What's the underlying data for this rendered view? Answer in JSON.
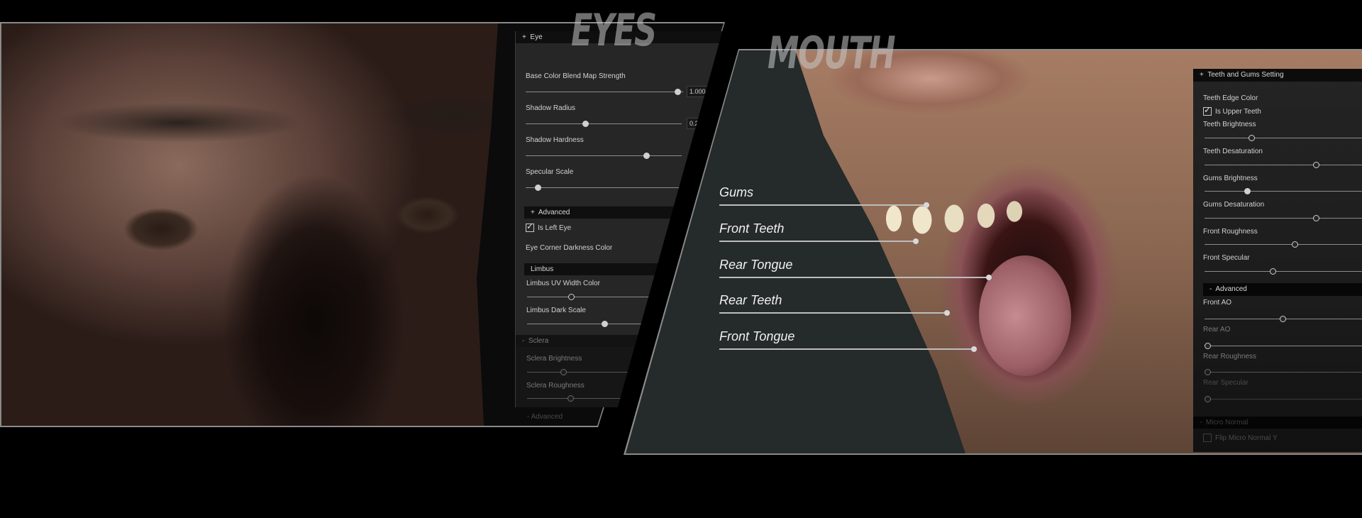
{
  "titles": {
    "eyes": "EYES",
    "mouth": "MOUTH"
  },
  "eyes_panel": {
    "section": {
      "icon": "+",
      "label": "Eye"
    },
    "sliders": [
      {
        "label": "Base Color Blend Map Strength",
        "value": 1.0,
        "value_text": "1.000",
        "position": 1.0,
        "knob": "filled"
      },
      {
        "label": "Shadow Radius",
        "value_text": "0.2",
        "position": 0.38,
        "knob": "filled"
      },
      {
        "label": "Shadow Hardness",
        "position": 0.78,
        "knob": "filled"
      },
      {
        "label": "Specular Scale",
        "position": 0.07,
        "knob": "filled"
      }
    ],
    "advanced": {
      "icon": "+",
      "label": "Advanced"
    },
    "is_left_eye": {
      "label": "Is Left Eye",
      "checked": true
    },
    "eye_corner_label": "Eye Corner Darkness Color",
    "limbus": {
      "label": "Limbus",
      "sliders": [
        {
          "label": "Limbus UV Width Color",
          "position": 0.37,
          "knob": "hollow"
        },
        {
          "label": "Limbus Dark Scale",
          "position": 0.66,
          "knob": "filled"
        }
      ]
    },
    "sclera": {
      "icon": "-",
      "label": "Sclera",
      "sliders": [
        {
          "label": "Sclera Brightness",
          "position": 0.36,
          "knob": "hollow"
        },
        {
          "label": "Sclera Roughness",
          "position": 0.46,
          "knob": "hollow"
        }
      ],
      "advanced": {
        "icon": "-",
        "label": "Advanced"
      }
    }
  },
  "mouth_callouts": [
    {
      "label": "Gums"
    },
    {
      "label": "Front Teeth"
    },
    {
      "label": "Rear Tongue"
    },
    {
      "label": "Rear Teeth"
    },
    {
      "label": "Front Tongue"
    }
  ],
  "mouth_panel": {
    "section": {
      "icon": "+",
      "label": "Teeth and Gums Setting"
    },
    "teeth_edge_color_label": "Teeth Edge Color",
    "is_upper_teeth": {
      "label": "Is Upper Teeth",
      "checked": true
    },
    "sliders": [
      {
        "label": "Teeth Brightness",
        "position": 0.3,
        "knob": "hollow"
      },
      {
        "label": "Teeth Desaturation",
        "position": 0.73,
        "knob": "hollow"
      },
      {
        "label": "Gums Brightness",
        "position": 0.28,
        "knob": "filled"
      },
      {
        "label": "Gums Desaturation",
        "position": 0.73,
        "knob": "hollow"
      },
      {
        "label": "Front Roughness",
        "position": 0.59,
        "knob": "hollow"
      },
      {
        "label": "Front Specular",
        "position": 0.45,
        "knob": "hollow"
      }
    ],
    "advanced": {
      "icon": "-",
      "label": "Advanced",
      "sliders": [
        {
          "label": "Front AO",
          "position": 0.51,
          "knob": "hollow"
        },
        {
          "label": "Rear AO",
          "position": 0.0,
          "knob": "hollow"
        },
        {
          "label": "Rear Roughness",
          "position": 0.0,
          "knob": "hollow"
        },
        {
          "label": "Rear Specular",
          "position": 0.0,
          "knob": "hollow"
        }
      ]
    },
    "micro_normal": {
      "icon": "-",
      "label": "Micro Normal"
    },
    "flip_micro_normal": {
      "label": "Flip Micro Normal Y",
      "checked": false
    }
  }
}
